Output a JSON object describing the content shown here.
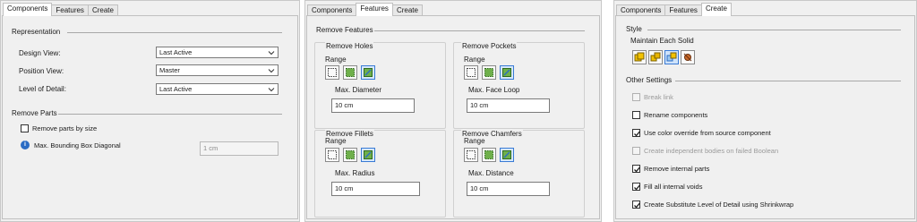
{
  "components_panel": {
    "tabs": [
      "Components",
      "Features",
      "Create"
    ],
    "representation_heading": "Representation",
    "design_view_label": "Design View:",
    "design_view_value": "Last Active",
    "position_view_label": "Position View:",
    "position_view_value": "Master",
    "lod_label": "Level of Detail:",
    "lod_value": "Last Active",
    "remove_parts_heading": "Remove Parts",
    "remove_by_size_label": "Remove parts by size",
    "remove_by_size_checked": false,
    "max_bbox_label": "Max. Bounding Box Diagonal",
    "max_bbox_value": "1 cm"
  },
  "features_panel": {
    "tabs": [
      "Components",
      "Features",
      "Create"
    ],
    "remove_features_heading": "Remove Features",
    "holes": {
      "title": "Remove Holes",
      "range_label": "Range",
      "param_label": "Max. Diameter",
      "value": "10 cm",
      "selected_range": 2
    },
    "pockets": {
      "title": "Remove Pockets",
      "range_label": "Range",
      "param_label": "Max. Face Loop",
      "value": "10 cm",
      "selected_range": 2
    },
    "fillets": {
      "title": "Remove Fillets",
      "range_label": "Range",
      "param_label": "Max. Radius",
      "value": "10 cm",
      "selected_range": 2
    },
    "chamfers": {
      "title": "Remove Chamfers",
      "range_label": "Range",
      "param_label": "Max. Distance",
      "value": "10 cm",
      "selected_range": 2
    }
  },
  "create_panel": {
    "tabs": [
      "Components",
      "Features",
      "Create"
    ],
    "style_heading": "Style",
    "style_option_label": "Maintain Each Solid",
    "selected_style": 2,
    "other_settings_heading": "Other Settings",
    "options": [
      {
        "label": "Break link",
        "checked": false,
        "disabled": true
      },
      {
        "label": "Rename components",
        "checked": false,
        "disabled": false
      },
      {
        "label": "Use color override from source component",
        "checked": true,
        "disabled": false
      },
      {
        "label": "Create independent bodies on failed Boolean",
        "checked": false,
        "disabled": true
      },
      {
        "label": "Remove internal parts",
        "checked": true,
        "disabled": false
      },
      {
        "label": "Fill all internal voids",
        "checked": true,
        "disabled": false
      },
      {
        "label": "Create Substitute Level of Detail using Shrinkwrap",
        "checked": true,
        "disabled": false
      }
    ]
  },
  "colors": {
    "panel_bg": "#f0f0f0",
    "selection_blue": "#3a7bd5",
    "info_blue": "#2b6cc4"
  }
}
